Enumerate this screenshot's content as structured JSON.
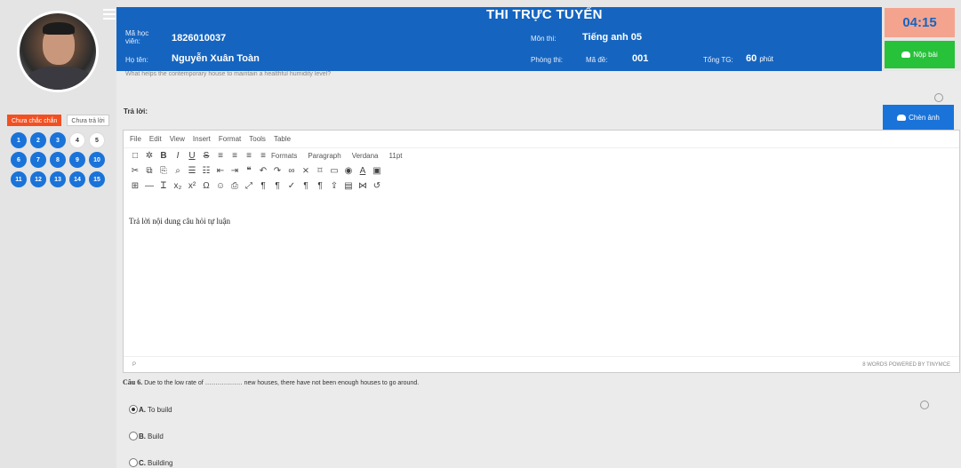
{
  "header": {
    "title": "THI TRỰC TUYẾN",
    "student_id_label": "Mã học viên:",
    "student_id": "1826010037",
    "name_label": "Họ tên:",
    "name": "Nguyễn Xuân Toàn",
    "subject_label": "Môn thi:",
    "subject": "Tiếng anh 05",
    "room_label": "Phòng thi:",
    "code_label": "Mã đề:",
    "code": "001",
    "total_time_label": "Tổng TG:",
    "total_time": "60",
    "total_time_unit": "phút",
    "timer": "04:15",
    "submit_label": "Nộp bài"
  },
  "sidebar": {
    "tab_uncertain": "Chưa chắc chắn",
    "tab_unanswered": "Chưa trả lời",
    "questions": [
      {
        "n": "1",
        "answered": true
      },
      {
        "n": "2",
        "answered": true
      },
      {
        "n": "3",
        "answered": true
      },
      {
        "n": "4",
        "answered": false
      },
      {
        "n": "5",
        "answered": false
      },
      {
        "n": "6",
        "answered": true
      },
      {
        "n": "7",
        "answered": true
      },
      {
        "n": "8",
        "answered": true
      },
      {
        "n": "9",
        "answered": true
      },
      {
        "n": "10",
        "answered": true
      },
      {
        "n": "11",
        "answered": true
      },
      {
        "n": "12",
        "answered": true
      },
      {
        "n": "13",
        "answered": true
      },
      {
        "n": "14",
        "answered": true
      },
      {
        "n": "15",
        "answered": true
      }
    ]
  },
  "main": {
    "prev_question": "What helps the contemporary house to maintain a healthful humidity level?",
    "answer_label": "Trả lời:",
    "insert_image_label": "Chèn ảnh",
    "editor": {
      "menus": [
        "File",
        "Edit",
        "View",
        "Insert",
        "Format",
        "Tools",
        "Table"
      ],
      "formats": "Formats",
      "block": "Paragraph",
      "font": "Verdana",
      "size": "11pt",
      "content": "Trả lời nội dung câu hỏi tự luận",
      "path": "P",
      "status": "8 WORDS POWERED BY TINYMCE"
    },
    "q6": {
      "number": "Câu 6.",
      "text": "Due to the low rate of ……………… new houses, there have not been enough houses to go around.",
      "options": [
        {
          "letter": "A.",
          "text": "To build",
          "checked": true
        },
        {
          "letter": "B.",
          "text": "Build",
          "checked": false
        },
        {
          "letter": "C.",
          "text": "Building",
          "checked": false
        }
      ]
    }
  }
}
